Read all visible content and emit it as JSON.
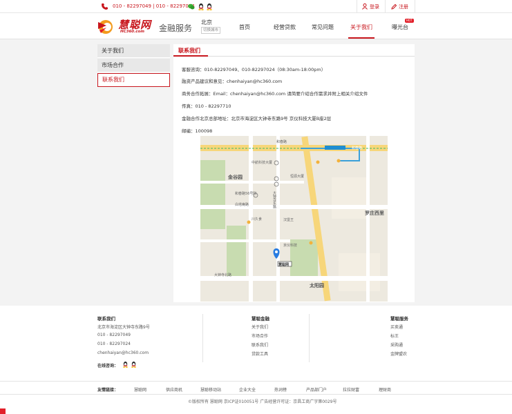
{
  "topbar": {
    "phone": "010 - 82297049 | 010 - 82297024",
    "login": "登录",
    "register": "注册"
  },
  "header": {
    "logo_text": "慧聪网",
    "logo_sub": "HC360.com",
    "site_title": "金融服务",
    "city": "北京",
    "switch_city": "切换城市",
    "nav": [
      "首页",
      "经营贷款",
      "常见问题",
      "关于我们",
      "曝光台"
    ],
    "hot_badge": "HOT"
  },
  "sidebar": {
    "items": [
      "关于我们",
      "市场合作",
      "联系我们"
    ]
  },
  "content": {
    "title": "联系我们",
    "lines": [
      "客服咨询：010-82297049、010-82297024（08:30am-18:00pm）",
      "融资产品建议和意见：chenhaiyan@hc360.com",
      "商务合作拓展：Email：chenhaiyan@hc360.com 请简要介绍合作需求并附上相关介绍文件",
      "传真：010 - 82297710",
      "金融合作北京总部地址：北京市海淀区大钟寺东路9号 京仪科技大厦B座2层",
      "邮编：100098"
    ]
  },
  "map": {
    "labels": {
      "jinguyuan": "金谷园",
      "luozhuang": "罗庄西里",
      "taiyangyuan": "太阳园",
      "hechunlu": "和春路",
      "hechunlu2": "和春路",
      "baishengbanglu": "白塔庵路",
      "dazhongsi": "大钟寺东路",
      "dazhongsibeilu": "大钟寺北路",
      "marker": "慧聪网",
      "building": "京仪科技大厦",
      "chuanjiu": "川久食",
      "hanbao": "汉堡王",
      "zhongzi": "中航科技大厦",
      "hengyang": "恒源大厦",
      "hechun56": "和春路56号院",
      "jinding": "锦鼎明珠",
      "jingyi": "京仪科技"
    }
  },
  "footer": {
    "col1_title": "联系我们",
    "col1_items": [
      "北京市海淀区大钟寺东路9号",
      "010 - 82297049",
      "010 - 82297024",
      "chenhaiyan@hc360.com"
    ],
    "online": "在线咨询：",
    "col2_title": "慧聪金融",
    "col2_items": [
      "关于我们",
      "市场合作",
      "联系我们",
      "贷款工具"
    ],
    "col3_title": "慧聪服务",
    "col3_items": [
      "买卖通",
      "标王",
      "采购通",
      "金牌盟农"
    ],
    "links_title": "友情链接：",
    "links": [
      "慧聪网",
      "供应商机",
      "慧聪移动站",
      "企业大全",
      "热词榜",
      "产品部门户",
      "拉拉财富",
      "理财商"
    ],
    "copyright": "©版权所有 慧聪网 京ICP证010051号 广告经营许可证：京昌工商广字第0029号"
  }
}
